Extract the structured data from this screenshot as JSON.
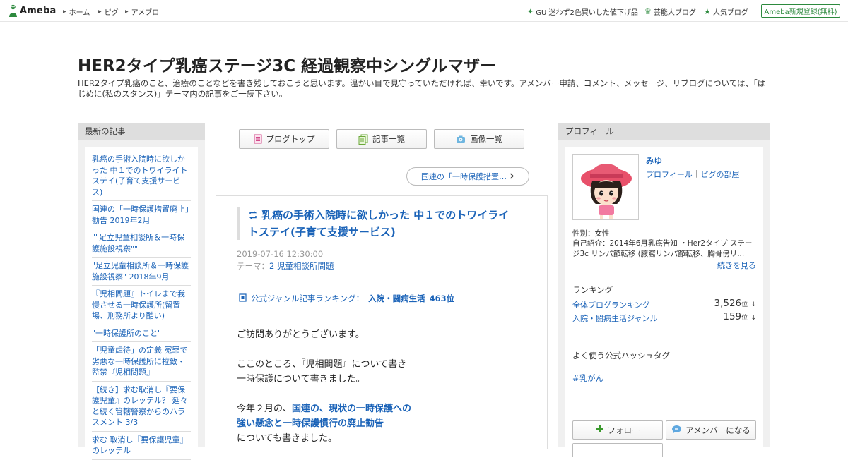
{
  "colors": {
    "accent": "#2d8a3e",
    "link": "#1b63b8"
  },
  "topbar": {
    "logo": "Ameba",
    "nav": [
      "ホーム",
      "ピグ",
      "アメブロ"
    ],
    "right_links": [
      {
        "icon": "sparkle-icon",
        "label": "GU 迷わず2色買いした値下げ品"
      },
      {
        "icon": "crown-icon",
        "label": "芸能人ブログ"
      },
      {
        "icon": "star-icon",
        "label": "人気ブログ"
      }
    ],
    "register": "Ameba新規登録(無料)"
  },
  "blog": {
    "title": "HER2タイプ乳癌ステージ3C 経過観察中シングルマザー",
    "description": "HER2タイプ乳癌のこと、治療のことなどを書き残しておこうと思います。温かい目で見守っていただければ、幸いです。アメンバー申請、コメント、メッセージ、リブログについては、「はじめに(私のスタンス)」テーマ内の記事をご一読下さい。"
  },
  "recent": {
    "heading": "最新の記事",
    "items": [
      "乳癌の手術入院時に欲しかった 中１でのトワイライトステイ(子育て支援サービス)",
      "国連の「一時保護措置廃止」勧告 2019年2月",
      "\"\"足立児童相談所＆一時保護施設視察\"\"",
      "\"足立児童相談所＆一時保護施設視察\" 2018年9月",
      "『児相問題』トイレまで我慢させる一時保護所(留置場、刑務所より酷い)",
      "\"一時保護所のこと\"",
      "「児童虐待」の定義 冤罪で劣悪な一時保護所に拉致・監禁『児相問題』",
      "【続き】求む取消し『要保護児童』のレッテル？ 延々と続く管轄警察からのハラスメント 3/3",
      "求む 取消し『要保護児童』のレッテル"
    ]
  },
  "tabs": [
    {
      "icon": "document-icon",
      "label": "ブログトップ"
    },
    {
      "icon": "pages-icon",
      "label": "記事一覧"
    },
    {
      "icon": "camera-icon",
      "label": "画像一覧"
    }
  ],
  "prev_article": "国連の「一時保護措置…",
  "article": {
    "title": "乳癌の手術入院時に欲しかった 中１でのトワイライトステイ(子育て支援サービス)",
    "date": "2019-07-16 12:30:00",
    "theme_label": "テーマ：",
    "theme": "2 児童相談所問題",
    "ranking_label": "公式ジャンル記事ランキング：",
    "ranking_genre": "入院・闘病生活",
    "ranking_value": "463位",
    "body": [
      {
        "text": "ご訪問ありがとうございます。",
        "link": false
      },
      {
        "text": "",
        "link": false
      },
      {
        "text": "ここのところ、『児相問題』について書き",
        "link": false
      },
      {
        "text": "一時保護について書きました。",
        "link": false
      },
      {
        "text": "",
        "link": false
      },
      {
        "text": "今年２月の、",
        "link": false,
        "link_text": "国連の、現状の一時保護への"
      },
      {
        "text": "強い懸念と一時保護慣行の廃止勧告",
        "link": true
      },
      {
        "text": "についても書きました。",
        "link": false
      }
    ]
  },
  "profile": {
    "heading": "プロフィール",
    "name": "みゆ",
    "link_profile": "プロフィール",
    "link_pig": "ピグの部屋",
    "gender": "性別：女性",
    "intro": "自己紹介：2014年6月乳癌告知 ・Her2タイプ ステージ3c リンパ節転移 (腋窩リンパ節転移、胸骨傍リ...",
    "more": "続きを見る",
    "ranking_heading": "ランキング",
    "rankings": [
      {
        "label": "全体ブログランキング",
        "value": "3,526",
        "unit": "位",
        "trend": "↓"
      },
      {
        "label": "入院・闘病生活ジャンル",
        "value": "159",
        "unit": "位",
        "trend": "↓"
      }
    ],
    "hashtag_heading": "よく使う公式ハッシュタグ",
    "hashtag": "#乳がん",
    "follow": "フォロー",
    "amember": "アメンバーになる"
  }
}
